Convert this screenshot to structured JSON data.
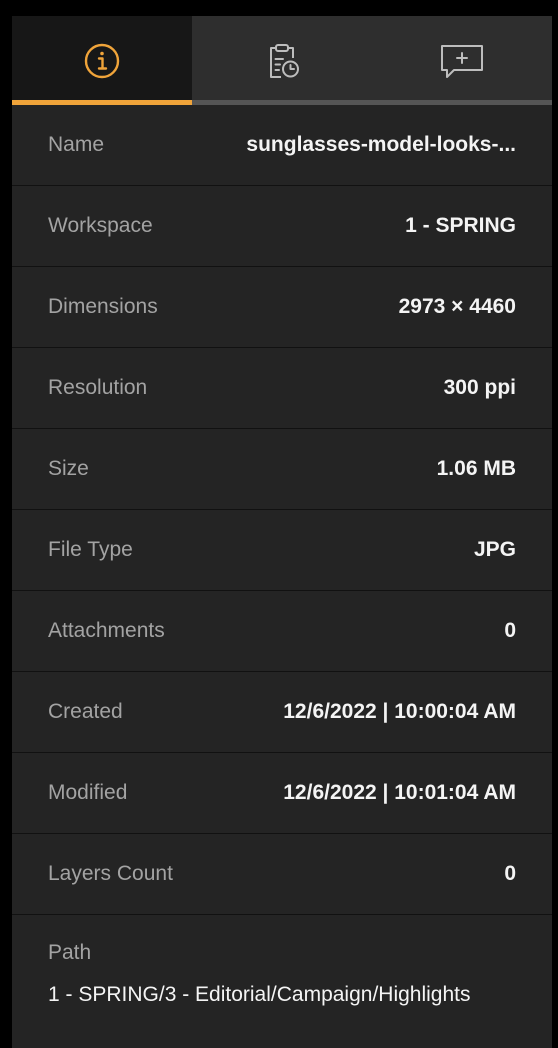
{
  "tabs": [
    {
      "icon": "info-icon",
      "active": true
    },
    {
      "icon": "clipboard-history-icon",
      "active": false
    },
    {
      "icon": "comment-add-icon",
      "active": false
    }
  ],
  "colors": {
    "accent": "#f0a43a",
    "panel": "#242424",
    "label": "#a3a3a3",
    "value": "#f4f4f4"
  },
  "details": {
    "name": {
      "label": "Name",
      "value": "sunglasses-model-looks-..."
    },
    "workspace": {
      "label": "Workspace",
      "value": "1 - SPRING"
    },
    "dimensions": {
      "label": "Dimensions",
      "value": "2973 × 4460"
    },
    "resolution": {
      "label": "Resolution",
      "value": "300 ppi"
    },
    "size": {
      "label": "Size",
      "value": "1.06 MB"
    },
    "file_type": {
      "label": "File Type",
      "value": "JPG"
    },
    "attachments": {
      "label": "Attachments",
      "value": "0"
    },
    "created": {
      "label": "Created",
      "value": "12/6/2022 | 10:00:04 AM"
    },
    "modified": {
      "label": "Modified",
      "value": "12/6/2022 | 10:01:04 AM"
    },
    "layers_count": {
      "label": "Layers Count",
      "value": "0"
    },
    "path": {
      "label": "Path",
      "value": "1 - SPRING/3 - Editorial/Campaign/Highlights"
    }
  }
}
